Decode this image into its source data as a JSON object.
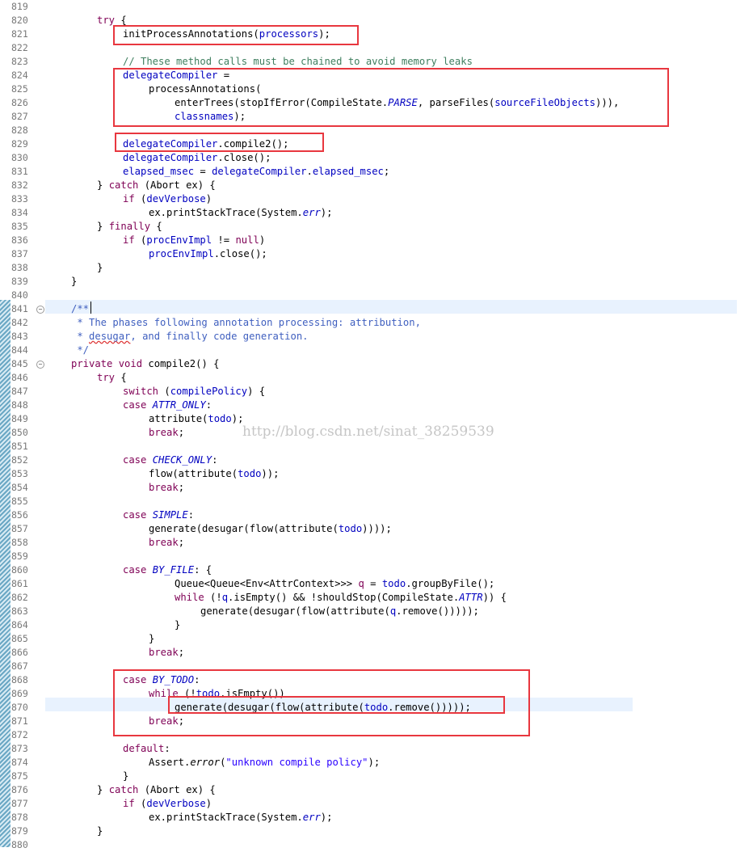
{
  "editor": {
    "language": "java",
    "current_line": 841,
    "watermark": "http://blog.csdn.net/sinat_38259539",
    "lines": [
      {
        "n": "819",
        "indent": 0,
        "tokens": []
      },
      {
        "n": "820",
        "indent": 2,
        "tokens": [
          {
            "t": "try",
            "c": "kw"
          },
          {
            "t": " {"
          }
        ]
      },
      {
        "n": "821",
        "indent": 3,
        "tokens": [
          {
            "t": "initProcessAnnotations("
          },
          {
            "t": "processors",
            "c": "fld"
          },
          {
            "t": ");"
          }
        ]
      },
      {
        "n": "822",
        "indent": 0,
        "tokens": []
      },
      {
        "n": "823",
        "indent": 3,
        "tokens": [
          {
            "t": "// These method calls must be chained to avoid memory leaks",
            "c": "cmt"
          }
        ]
      },
      {
        "n": "824",
        "indent": 3,
        "tokens": [
          {
            "t": "delegateCompiler",
            "c": "fld"
          },
          {
            "t": " ="
          }
        ]
      },
      {
        "n": "825",
        "indent": 4,
        "tokens": [
          {
            "t": "processAnnotations("
          }
        ]
      },
      {
        "n": "826",
        "indent": 5,
        "tokens": [
          {
            "t": "enterTrees(stopIfError(CompileState."
          },
          {
            "t": "PARSE",
            "c": "fld it"
          },
          {
            "t": ", parseFiles("
          },
          {
            "t": "sourceFileObjects",
            "c": "fld"
          },
          {
            "t": "))),"
          }
        ]
      },
      {
        "n": "827",
        "indent": 5,
        "tokens": [
          {
            "t": "classnames",
            "c": "fld"
          },
          {
            "t": ");"
          }
        ]
      },
      {
        "n": "828",
        "indent": 0,
        "tokens": []
      },
      {
        "n": "829",
        "indent": 3,
        "tokens": [
          {
            "t": "delegateCompiler",
            "c": "fld"
          },
          {
            "t": ".compile2();"
          }
        ]
      },
      {
        "n": "830",
        "indent": 3,
        "tokens": [
          {
            "t": "delegateCompiler",
            "c": "fld"
          },
          {
            "t": ".close();"
          }
        ]
      },
      {
        "n": "831",
        "indent": 3,
        "tokens": [
          {
            "t": "elapsed_msec",
            "c": "fld"
          },
          {
            "t": " = "
          },
          {
            "t": "delegateCompiler",
            "c": "fld"
          },
          {
            "t": "."
          },
          {
            "t": "elapsed_msec",
            "c": "fld"
          },
          {
            "t": ";"
          }
        ]
      },
      {
        "n": "832",
        "indent": 2,
        "tokens": [
          {
            "t": "} "
          },
          {
            "t": "catch",
            "c": "kw"
          },
          {
            "t": " (Abort ex) {"
          }
        ]
      },
      {
        "n": "833",
        "indent": 3,
        "tokens": [
          {
            "t": "if",
            "c": "kw"
          },
          {
            "t": " ("
          },
          {
            "t": "devVerbose",
            "c": "fld"
          },
          {
            "t": ")"
          }
        ]
      },
      {
        "n": "834",
        "indent": 4,
        "tokens": [
          {
            "t": "ex.printStackTrace(System."
          },
          {
            "t": "err",
            "c": "fld it"
          },
          {
            "t": ");"
          }
        ]
      },
      {
        "n": "835",
        "indent": 2,
        "tokens": [
          {
            "t": "} "
          },
          {
            "t": "finally",
            "c": "kw"
          },
          {
            "t": " {"
          }
        ]
      },
      {
        "n": "836",
        "indent": 3,
        "tokens": [
          {
            "t": "if",
            "c": "kw"
          },
          {
            "t": " ("
          },
          {
            "t": "procEnvImpl",
            "c": "fld"
          },
          {
            "t": " != "
          },
          {
            "t": "null",
            "c": "kw"
          },
          {
            "t": ")"
          }
        ]
      },
      {
        "n": "837",
        "indent": 4,
        "tokens": [
          {
            "t": "procEnvImpl",
            "c": "fld"
          },
          {
            "t": ".close();"
          }
        ]
      },
      {
        "n": "838",
        "indent": 2,
        "tokens": [
          {
            "t": "}"
          }
        ]
      },
      {
        "n": "839",
        "indent": 1,
        "tokens": [
          {
            "t": "}"
          }
        ]
      },
      {
        "n": "840",
        "indent": 0,
        "tokens": []
      },
      {
        "n": "841",
        "indent": 1,
        "fold": true,
        "tokens": [
          {
            "t": "/**",
            "c": "doc"
          }
        ]
      },
      {
        "n": "842",
        "indent": 1,
        "tokens": [
          {
            "t": " * The phases following annotation processing: attribution,",
            "c": "doc"
          }
        ]
      },
      {
        "n": "843",
        "indent": 1,
        "tokens": [
          {
            "t": " * ",
            "c": "doc"
          },
          {
            "t": "desugar",
            "c": "doc ul"
          },
          {
            "t": ", and finally code generation.",
            "c": "doc"
          }
        ]
      },
      {
        "n": "844",
        "indent": 1,
        "tokens": [
          {
            "t": " */",
            "c": "doc"
          }
        ]
      },
      {
        "n": "845",
        "indent": 1,
        "fold": true,
        "tokens": [
          {
            "t": "private",
            "c": "kw"
          },
          {
            "t": " "
          },
          {
            "t": "void",
            "c": "kw"
          },
          {
            "t": " compile2() {"
          }
        ]
      },
      {
        "n": "846",
        "indent": 2,
        "tokens": [
          {
            "t": "try",
            "c": "kw"
          },
          {
            "t": " {"
          }
        ]
      },
      {
        "n": "847",
        "indent": 3,
        "tokens": [
          {
            "t": "switch",
            "c": "kw"
          },
          {
            "t": " ("
          },
          {
            "t": "compilePolicy",
            "c": "fld"
          },
          {
            "t": ") {"
          }
        ]
      },
      {
        "n": "848",
        "indent": 3,
        "tokens": [
          {
            "t": "case",
            "c": "kw"
          },
          {
            "t": " "
          },
          {
            "t": "ATTR_ONLY",
            "c": "fld it"
          },
          {
            "t": ":"
          }
        ]
      },
      {
        "n": "849",
        "indent": 4,
        "tokens": [
          {
            "t": "attribute("
          },
          {
            "t": "todo",
            "c": "fld"
          },
          {
            "t": ");"
          }
        ]
      },
      {
        "n": "850",
        "indent": 4,
        "tokens": [
          {
            "t": "break",
            "c": "kw"
          },
          {
            "t": ";"
          }
        ]
      },
      {
        "n": "851",
        "indent": 0,
        "tokens": []
      },
      {
        "n": "852",
        "indent": 3,
        "tokens": [
          {
            "t": "case",
            "c": "kw"
          },
          {
            "t": " "
          },
          {
            "t": "CHECK_ONLY",
            "c": "fld it"
          },
          {
            "t": ":"
          }
        ]
      },
      {
        "n": "853",
        "indent": 4,
        "tokens": [
          {
            "t": "flow(attribute("
          },
          {
            "t": "todo",
            "c": "fld"
          },
          {
            "t": "));"
          }
        ]
      },
      {
        "n": "854",
        "indent": 4,
        "tokens": [
          {
            "t": "break",
            "c": "kw"
          },
          {
            "t": ";"
          }
        ]
      },
      {
        "n": "855",
        "indent": 0,
        "tokens": []
      },
      {
        "n": "856",
        "indent": 3,
        "tokens": [
          {
            "t": "case",
            "c": "kw"
          },
          {
            "t": " "
          },
          {
            "t": "SIMPLE",
            "c": "fld it"
          },
          {
            "t": ":"
          }
        ]
      },
      {
        "n": "857",
        "indent": 4,
        "tokens": [
          {
            "t": "generate(desugar(flow(attribute("
          },
          {
            "t": "todo",
            "c": "fld"
          },
          {
            "t": "))));"
          }
        ]
      },
      {
        "n": "858",
        "indent": 4,
        "tokens": [
          {
            "t": "break",
            "c": "kw"
          },
          {
            "t": ";"
          }
        ]
      },
      {
        "n": "859",
        "indent": 0,
        "tokens": []
      },
      {
        "n": "860",
        "indent": 3,
        "tokens": [
          {
            "t": "case",
            "c": "kw"
          },
          {
            "t": " "
          },
          {
            "t": "BY_FILE",
            "c": "fld it"
          },
          {
            "t": ": {"
          }
        ]
      },
      {
        "n": "861",
        "indent": 5,
        "tokens": [
          {
            "t": "Queue<Queue<Env<AttrContext>>> "
          },
          {
            "t": "q",
            "c": "kw"
          },
          {
            "t": " = "
          },
          {
            "t": "todo",
            "c": "fld"
          },
          {
            "t": ".groupByFile();"
          }
        ]
      },
      {
        "n": "862",
        "indent": 5,
        "tokens": [
          {
            "t": "while",
            "c": "kw"
          },
          {
            "t": " (!"
          },
          {
            "t": "q",
            "c": "fld"
          },
          {
            "t": ".isEmpty() && !shouldStop(CompileState."
          },
          {
            "t": "ATTR",
            "c": "fld it"
          },
          {
            "t": ")) {"
          }
        ]
      },
      {
        "n": "863",
        "indent": 6,
        "tokens": [
          {
            "t": "generate(desugar(flow(attribute("
          },
          {
            "t": "q",
            "c": "fld"
          },
          {
            "t": ".remove()))));"
          }
        ]
      },
      {
        "n": "864",
        "indent": 5,
        "tokens": [
          {
            "t": "}"
          }
        ]
      },
      {
        "n": "865",
        "indent": 4,
        "tokens": [
          {
            "t": "}"
          }
        ]
      },
      {
        "n": "866",
        "indent": 4,
        "tokens": [
          {
            "t": "break",
            "c": "kw"
          },
          {
            "t": ";"
          }
        ]
      },
      {
        "n": "867",
        "indent": 0,
        "tokens": []
      },
      {
        "n": "868",
        "indent": 3,
        "tokens": [
          {
            "t": "case",
            "c": "kw"
          },
          {
            "t": " "
          },
          {
            "t": "BY_TODO",
            "c": "fld it"
          },
          {
            "t": ":"
          }
        ]
      },
      {
        "n": "869",
        "indent": 4,
        "tokens": [
          {
            "t": "while",
            "c": "kw"
          },
          {
            "t": " (!"
          },
          {
            "t": "todo",
            "c": "fld"
          },
          {
            "t": ".isEmpty())"
          }
        ]
      },
      {
        "n": "870",
        "indent": 5,
        "tokens": [
          {
            "t": "generate(desugar(flow(attribute("
          },
          {
            "t": "todo",
            "c": "fld"
          },
          {
            "t": ".remove()))));"
          }
        ]
      },
      {
        "n": "871",
        "indent": 4,
        "tokens": [
          {
            "t": "break",
            "c": "kw"
          },
          {
            "t": ";"
          }
        ]
      },
      {
        "n": "872",
        "indent": 0,
        "tokens": []
      },
      {
        "n": "873",
        "indent": 3,
        "tokens": [
          {
            "t": "default",
            "c": "kw"
          },
          {
            "t": ":"
          }
        ]
      },
      {
        "n": "874",
        "indent": 4,
        "tokens": [
          {
            "t": "Assert."
          },
          {
            "t": "error",
            "c": "it"
          },
          {
            "t": "("
          },
          {
            "t": "\"unknown compile policy\"",
            "c": "str"
          },
          {
            "t": ");"
          }
        ]
      },
      {
        "n": "875",
        "indent": 3,
        "tokens": [
          {
            "t": "}"
          }
        ]
      },
      {
        "n": "876",
        "indent": 2,
        "tokens": [
          {
            "t": "} "
          },
          {
            "t": "catch",
            "c": "kw"
          },
          {
            "t": " (Abort ex) {"
          }
        ]
      },
      {
        "n": "877",
        "indent": 3,
        "tokens": [
          {
            "t": "if",
            "c": "kw"
          },
          {
            "t": " ("
          },
          {
            "t": "devVerbose",
            "c": "fld"
          },
          {
            "t": ")"
          }
        ]
      },
      {
        "n": "878",
        "indent": 4,
        "tokens": [
          {
            "t": "ex.printStackTrace(System."
          },
          {
            "t": "err",
            "c": "fld it"
          },
          {
            "t": ");"
          }
        ]
      },
      {
        "n": "879",
        "indent": 2,
        "tokens": [
          {
            "t": "}"
          }
        ]
      },
      {
        "n": "880",
        "indent": 0,
        "tokens": []
      }
    ]
  }
}
